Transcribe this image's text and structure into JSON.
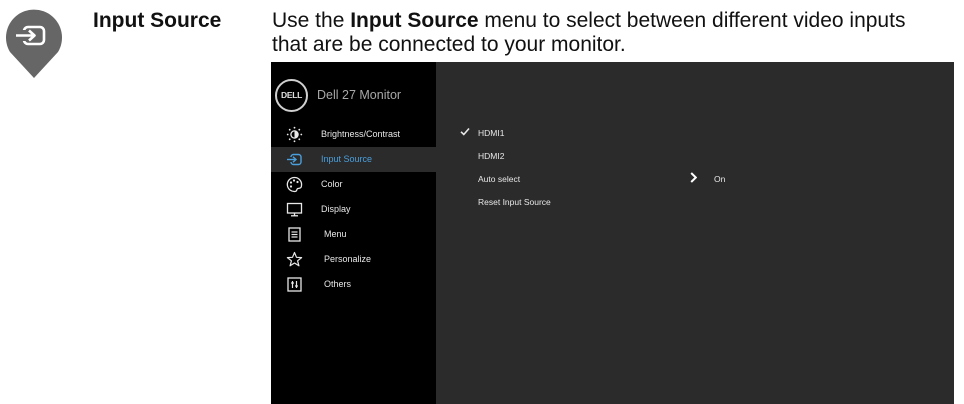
{
  "section": {
    "title": "Input Source",
    "description_prefix": "Use the ",
    "description_bold": "Input Source",
    "description_suffix": " menu to select between different video inputs that are be connected to your monitor."
  },
  "osd": {
    "logo_text": "DELL",
    "brand_name": "Dell 27 Monitor",
    "menu_items": [
      {
        "label": "Brightness/Contrast",
        "icon": "brightness-icon",
        "active": false
      },
      {
        "label": "Input Source",
        "icon": "input-source-icon",
        "active": true
      },
      {
        "label": "Color",
        "icon": "color-palette-icon",
        "active": false
      },
      {
        "label": "Display",
        "icon": "display-icon",
        "active": false
      },
      {
        "label": "Menu",
        "icon": "menu-icon",
        "active": false
      },
      {
        "label": "Personalize",
        "icon": "star-icon",
        "active": false
      },
      {
        "label": "Others",
        "icon": "others-icon",
        "active": false
      }
    ],
    "options": [
      {
        "label": "HDMI1",
        "checked": true
      },
      {
        "label": "HDMI2",
        "checked": false
      },
      {
        "label": "Auto select",
        "has_submenu": true,
        "value": "On"
      },
      {
        "label": "Reset Input Source"
      }
    ],
    "colors": {
      "active_item": "#4a9fdc",
      "left_panel": "#000000",
      "right_panel": "#2b2b2b",
      "marker": "#666666"
    }
  }
}
